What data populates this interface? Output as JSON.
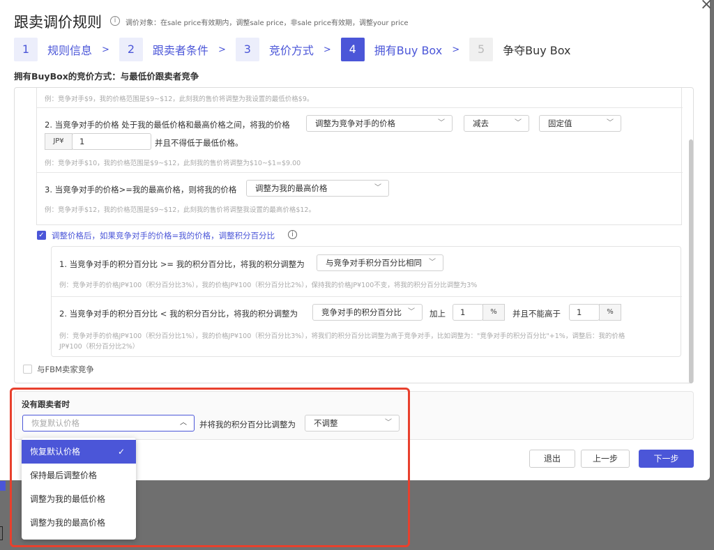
{
  "header": {
    "title": "跟卖调价规则",
    "tip": "调价对象：在sale price有效期内，调整sale price，非sale price有效期，调整your price"
  },
  "steps": [
    {
      "num": "1",
      "label": "规则信息"
    },
    {
      "num": "2",
      "label": "跟卖者条件"
    },
    {
      "num": "3",
      "label": "竞价方式"
    },
    {
      "num": "4",
      "label": "拥有Buy Box"
    },
    {
      "num": "5",
      "label": "争夺Buy Box"
    }
  ],
  "step_separator": ">",
  "subheading": "拥有BuyBox的竞价方式：与最低价跟卖者竞争",
  "rules": {
    "r1_hint": "例：竞争对手$9，我的价格范围是$9~$12，此刻我的售价将调整为我设置的最低价格$9。",
    "r2_text": "2. 当竞争对手的价格 处于我的最低价格和最高价格之间，将我的价格",
    "r2_select1": "调整为竞争对手的价格",
    "r2_select2": "减去",
    "r2_select3": "固定值",
    "r2_currency": "JP¥",
    "r2_value": "1",
    "r2_suffix": "并且不得低于最低价格。",
    "r2_hint": "例：竞争对手$10，我的价格范围是$9~$12，此刻我的售价将调整为$10~$1=$9.00",
    "r3_text": "3. 当竞争对手的价格>=我的最高价格，则将我的价格",
    "r3_select": "调整为我的最高价格",
    "r3_hint": "例：竞争对手$12，我的价格范围是$9~$12，此刻我的售价将调整我设置的最高价格$12。"
  },
  "points": {
    "checkbox_label": "调整价格后，如果竞争对手的价格=我的价格，调整积分百分比",
    "p1_text": "1. 当竞争对手的积分百分比 >= 我的积分百分比，将我的积分调整为",
    "p1_select": "与竞争对手积分百分比相同",
    "p1_hint": "例：竞争对手的价格JP¥100（积分百分比3%），我的价格JP¥100（积分百分比2%），保持我的价格JP¥100不变，将我的积分百分比调整为3%",
    "p2_text": "2. 当竞争对手的积分百分比 < 我的积分百分比，将我的积分调整为",
    "p2_select": "竞争对手的积分百分比",
    "p2_plus": "加上",
    "p2_value1": "1",
    "p2_unit": "%",
    "p2_and": "并且不能高于",
    "p2_value2": "1",
    "p2_hint_line1": "例：竞争对手的价格JP¥100（积分百分比1%），我的价格JP¥100（积分百分比3%），将我们的积分百分比调整为高于竞争对手，比如调整为：\"竞争对手的积分百分比\"+1%，调整后：我的价格",
    "p2_hint_line2": "JP¥100（积分百分比2%）"
  },
  "fbm_label": "与FBM卖家竞争",
  "no_follower": {
    "title": "没有跟卖者时",
    "placeholder": "恢复默认价格",
    "points_text": "并将我的积分百分比调整为",
    "points_select": "不调整"
  },
  "dropdown_options": [
    {
      "label": "恢复默认价格",
      "selected": true
    },
    {
      "label": "保持最后调整价格",
      "selected": false
    },
    {
      "label": "调整为我的最低价格",
      "selected": false
    },
    {
      "label": "调整为我的最高价格",
      "selected": false
    }
  ],
  "footer": {
    "exit": "退出",
    "prev": "上一步",
    "next": "下一步"
  },
  "colors": {
    "accent": "#4b56d8",
    "highlight_border": "#e8402d"
  }
}
